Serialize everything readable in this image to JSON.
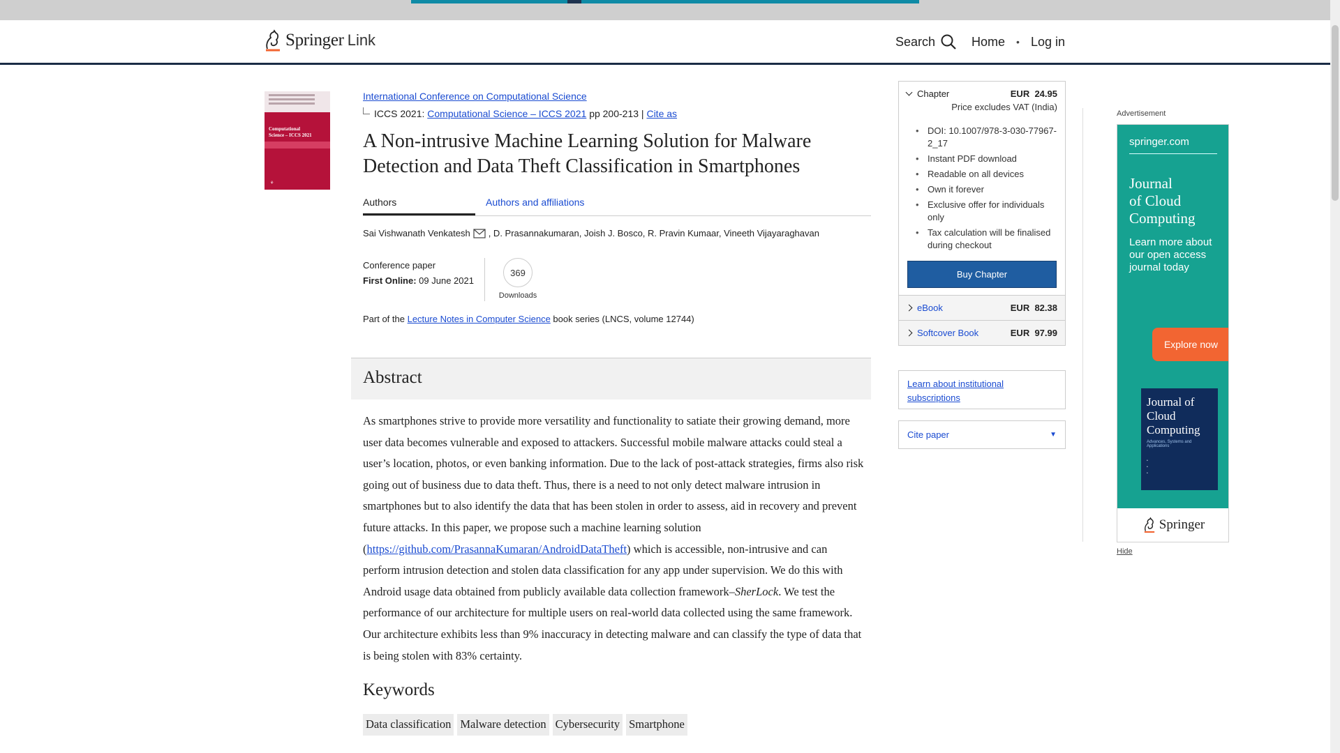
{
  "header": {
    "brand": "Springer",
    "brand_suffix": "Link",
    "search_label": "Search",
    "home_label": "Home",
    "separator": "•",
    "login_label": "Log in"
  },
  "cover": {
    "title_line1": "Computational",
    "title_line2": "Science – ICCS 2021"
  },
  "article": {
    "conference_link": "International Conference on Computational Science",
    "ics_prefix": "ICCS 2021:",
    "proceedings_link": "Computational Science – ICCS 2021",
    "pages": "pp 200-213",
    "pipe": "|",
    "cite_as": "Cite as",
    "title": "A Non-intrusive Machine Learning Solution for Malware Detection and Data Theft Classification in Smartphones",
    "tab_authors": "Authors",
    "tab_affiliations": "Authors and affiliations",
    "first_author": "Sai Vishwanath Venkatesh",
    "other_authors": ", D. Prasannakumaran, Joish J. Bosco, R. Pravin Kumaar, Vineeth Vijayaraghavan",
    "paper_type": "Conference paper",
    "first_online_label": "First Online:",
    "first_online_date": " 09 June 2021",
    "downloads_count": "369",
    "downloads_label": "Downloads",
    "part_of_prefix": "Part of the ",
    "series_link": "Lecture Notes in Computer Science",
    "part_of_suffix": " book series (LNCS, volume 12744)"
  },
  "abstract": {
    "heading": "Abstract",
    "text_1": "As smartphones strive to provide more versatility and functionality to satiate their growing demand, more user data becomes vulnerable and exposed to attackers. Successful mobile malware attacks could steal a user’s location, photos, or even banking information. Due to the lack of post-attack strategies, firms also risk going out of business due to data theft. Thus, there is a need to not only detect malware intrusion in smartphones but to also identify the data that has been stolen in order to assess, aid in recovery and prevent future attacks. In this paper, we propose such a machine learning solution (",
    "github_link": "https://github.com/PrasannaKumaran/AndroidDataTheft",
    "text_2": ") which is accessible, non-intrusive and can perform intrusion detection and stolen data classification for any app under supervision. We do this with Android usage data obtained from publicly available data collection framework–",
    "sherlock": "SherLock",
    "text_3": ". We test the performance of our architecture for multiple users on real-world data collected using the same framework. Our architecture exhibits less than 9% inaccuracy in detecting malware and can classify the type of data that is being stolen with 83% certainty."
  },
  "keywords": {
    "heading": "Keywords",
    "items": [
      "Data classification",
      "Malware detection",
      "Cybersecurity",
      "Smartphone"
    ]
  },
  "purchase": {
    "chapter_label": "Chapter",
    "currency": "EUR",
    "chapter_price": "24.95",
    "vat_note": "Price excludes VAT (India)",
    "features": [
      "DOI: 10.1007/978-3-030-77967-2_17",
      "Instant PDF download",
      "Readable on all devices",
      "Own it forever",
      "Exclusive offer for individuals only",
      "Tax calculation will be finalised during checkout"
    ],
    "buy_button": "Buy Chapter",
    "ebook_label": "eBook",
    "ebook_price": "82.38",
    "softcover_label": "Softcover Book",
    "softcover_price": "97.99"
  },
  "sidebar": {
    "institutional_link": "Learn about institutional subscriptions",
    "cite_paper": "Cite paper",
    "cite_arrow": "▼"
  },
  "ad": {
    "label": "Advertisement",
    "site": "springer.com",
    "journal_line1": "Journal",
    "journal_line2": "of Cloud",
    "journal_line3": "Computing",
    "learn_more": "Learn more about our open access journal today",
    "explore": "Explore now",
    "book_title": "Journal of Cloud Computing",
    "book_sub": "Advances, Systems and Applications",
    "footer_brand": "Springer",
    "hide": "Hide"
  },
  "colors": {
    "link": "#1a4bd1",
    "buy_button": "#1f5da1",
    "header_border": "#1a2b45",
    "ad_background": "#16a291",
    "explore_button": "#f26532"
  }
}
